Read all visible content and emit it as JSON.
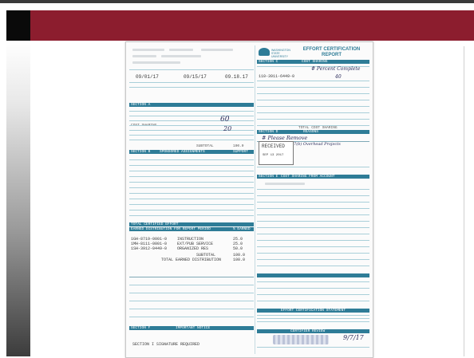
{
  "document": {
    "title_line1": "EFFORT CERTIFICATION",
    "title_line2": "REPORT",
    "university": "WASHINGTON STATE UNIVERSITY",
    "dates": [
      "09/01/17",
      "09/15/17",
      "09.18.17"
    ],
    "sections": {
      "a": "SECTION A",
      "b": "SECTION B",
      "c": "SECTION C",
      "d": "SECTION D",
      "e": "SECTION E",
      "f": "SECTION F"
    },
    "labels": {
      "cost_sharing": "COST SHARING",
      "sponsored_assignments": "SPONSORED ASSIGNMENTS",
      "support": "SUPPORT",
      "subtotal": "SUBTOTAL",
      "subtotal_value": "100.0",
      "total_certified_effort": "TOTAL CERTIFIED EFFORT",
      "earned_distribution": "EARNED DISTRIBUTION FOR REPORT PERIOD",
      "pct_earned": "% EARNED",
      "total_cost_sharing": "TOTAL COST SHARING",
      "reasons": "REASONS",
      "cost_sharing_from_account": "COST SHARING FROM ACCOUNT",
      "important_notice": "IMPORTANT NOTICE",
      "signature_required": "SECTION I  SIGNATURE REQUIRED",
      "certification_statement": "EFFORT CERTIFICATION STATEMENT",
      "certifier_review": "CERTIFIER REVIEW"
    },
    "accounts_top": "110-3911-6449-0",
    "earned_rows": [
      {
        "account": "1GH-8719-0001-0",
        "desc": "INSTRUCTION",
        "pct": "25.0"
      },
      {
        "account": "1MH-8111-0001-0",
        "desc": "EXT/PUB SERVICE",
        "pct": "25.0"
      },
      {
        "account": "1SH-3912-0449-0",
        "desc": "ORGANIZED RES",
        "pct": "50.0"
      }
    ],
    "earned_subtotal": "SUBTOTAL",
    "earned_subtotal_value": "100.0",
    "earned_total": "TOTAL EARNED DISTRIBUTION",
    "earned_total_value": "100.0",
    "handwriting": {
      "a_note": "# Percent Complete",
      "a_number": "40",
      "b_pct1": "60",
      "b_pct2": "20",
      "reason1": "# Please Remove",
      "reason2": "11-7(b) Overhead Projects",
      "stamp_title": "RECEIVED",
      "stamp_date": "SEP 13 2017",
      "date_sig": "9/7/17"
    }
  }
}
